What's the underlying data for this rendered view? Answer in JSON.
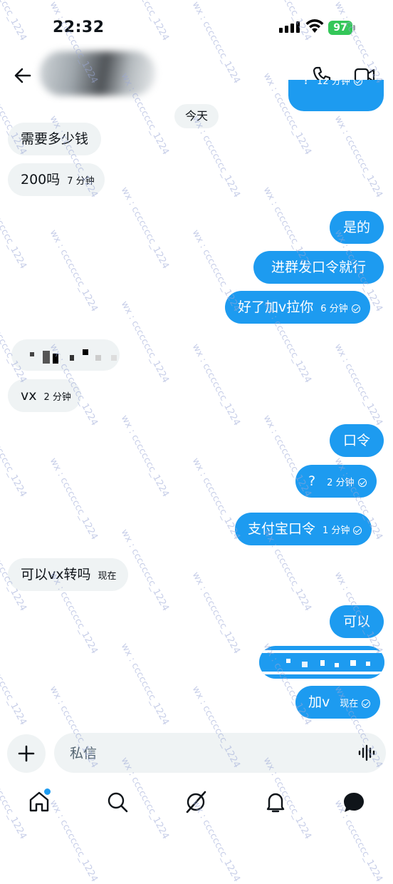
{
  "status_bar": {
    "time": "22:32",
    "battery": "97"
  },
  "header": {
    "back_icon": "arrow-left-icon",
    "call_icon": "phone-icon",
    "video_icon": "video-icon"
  },
  "date_separator": "今天",
  "messages": [
    {
      "dir": "out",
      "text": "?",
      "time": "12 分钟",
      "partial": true
    },
    {
      "dir": "in",
      "text": "需要多少钱"
    },
    {
      "dir": "in",
      "text": "200吗",
      "time": "7 分钟"
    },
    {
      "dir": "out",
      "text": "是的"
    },
    {
      "dir": "out",
      "text": "进群发口令就行"
    },
    {
      "dir": "out",
      "text": "好了加v拉你",
      "time": "6 分钟"
    },
    {
      "dir": "in",
      "text": "",
      "redacted": true
    },
    {
      "dir": "in",
      "text": "vx",
      "time": "2 分钟"
    },
    {
      "dir": "out",
      "text": "口令"
    },
    {
      "dir": "out",
      "text": "?",
      "time": "2 分钟"
    },
    {
      "dir": "out",
      "text": "支付宝口令",
      "time": "1 分钟"
    },
    {
      "dir": "in",
      "text": "可以vx转吗",
      "time": "现在"
    },
    {
      "dir": "out",
      "text": "可以"
    },
    {
      "dir": "out",
      "text": "",
      "redacted": true
    },
    {
      "dir": "out",
      "text": "加v",
      "time": "现在"
    }
  ],
  "composer": {
    "placeholder": "私信"
  },
  "bottom_nav": [
    "home-icon",
    "search-icon",
    "grok-icon",
    "notifications-icon",
    "messages-icon"
  ],
  "watermark": "wx : cccccccc_1224",
  "colors": {
    "accent": "#1d9bf0",
    "incoming_bubble": "#eff3f4",
    "battery": "#34c759"
  }
}
